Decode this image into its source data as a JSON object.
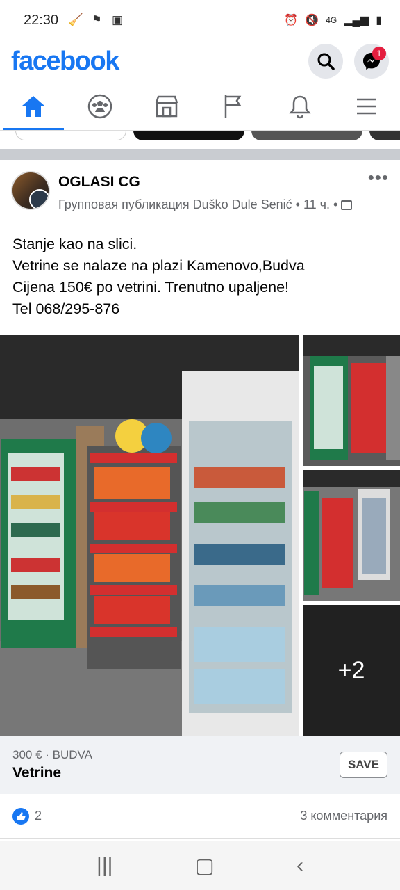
{
  "status": {
    "time": "22:30",
    "left_icons": [
      "broom-icon",
      "tray-icon",
      "screenshot-icon"
    ],
    "network": "4G"
  },
  "header": {
    "logo": "facebook",
    "messenger_badge": "1"
  },
  "tabs": [
    {
      "icon": "home-icon",
      "active": true
    },
    {
      "icon": "groups-icon",
      "active": false
    },
    {
      "icon": "marketplace-icon",
      "active": false
    },
    {
      "icon": "pages-flag-icon",
      "active": false
    },
    {
      "icon": "notifications-bell-icon",
      "active": false
    },
    {
      "icon": "menu-icon",
      "active": false
    }
  ],
  "post": {
    "group_name": "OGLASI CG",
    "sub_line": "Групповая публикация Duško Dule Senić • 11 ч. •",
    "text_lines": [
      "Stanje kao na slici.",
      "Vetrine se nalaze na plazi Kamenovo,Budva",
      "Cijena 150€ po vetrini. Trenutno upaljene!",
      "Tel 068/295-876"
    ],
    "more_images": "+2",
    "listing": {
      "price": "300 € · BUDVA",
      "title": "Vetrine",
      "save_label": "SAVE"
    },
    "reaction_count": "2",
    "comments_label": "3 комментария"
  },
  "colors": {
    "brand": "#1877f2",
    "badge": "#e41e3f"
  }
}
